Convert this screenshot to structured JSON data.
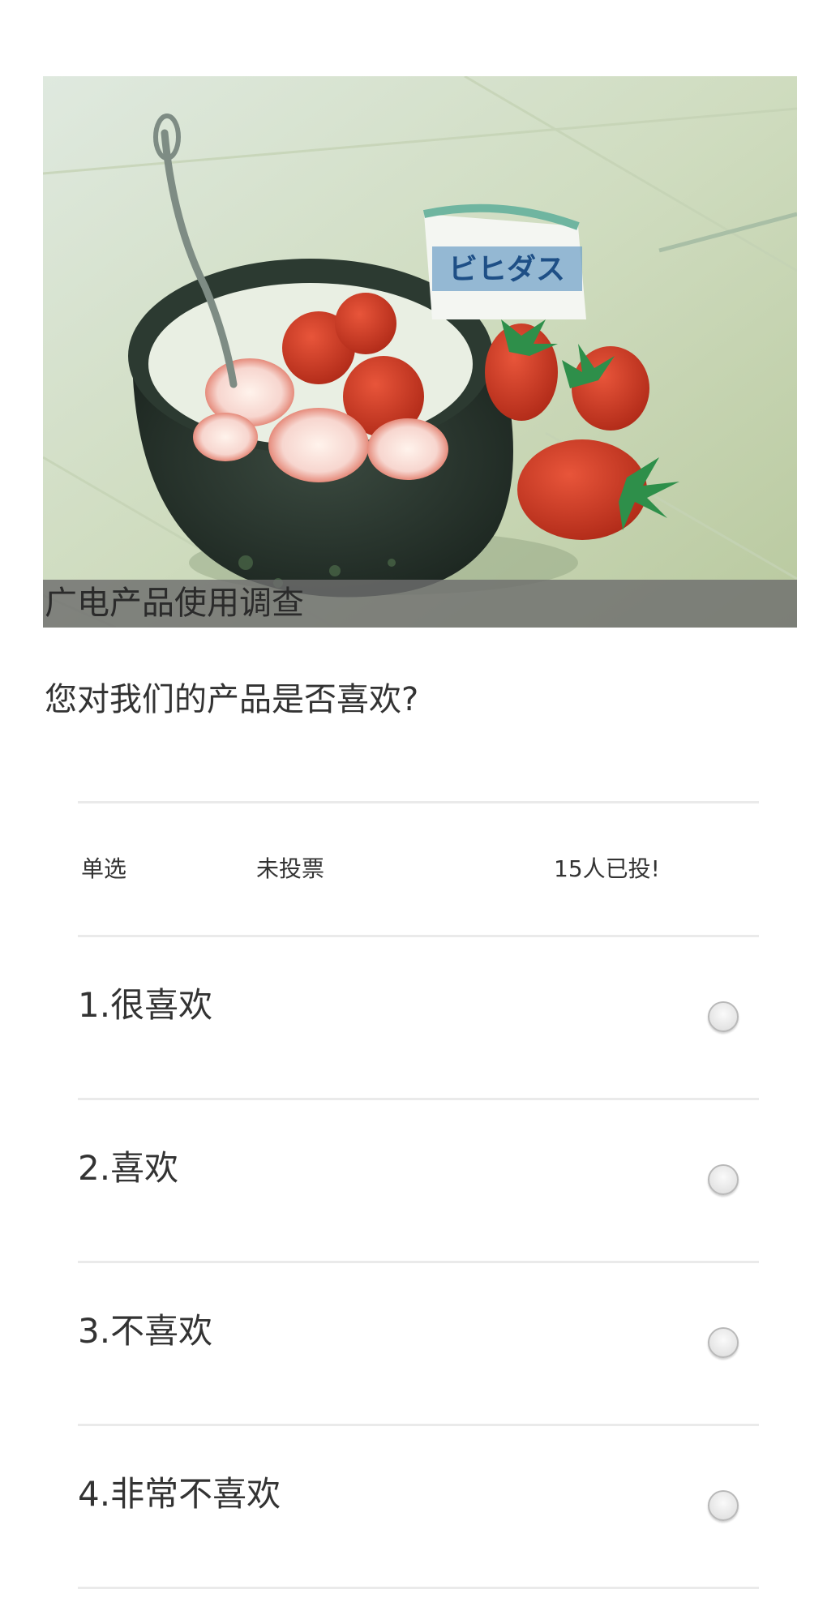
{
  "banner": {
    "image_alt": "bowl of strawberries with spoon and yogurt cup",
    "yogurt_brand": "ビヒダス"
  },
  "survey": {
    "title": "广电产品使用调查",
    "question": "您对我们的产品是否喜欢?",
    "type": "单选",
    "status": "未投票",
    "count": "15人已投!"
  },
  "options": [
    {
      "label": "1.很喜欢",
      "selected": false
    },
    {
      "label": "2.喜欢",
      "selected": false
    },
    {
      "label": "3.不喜欢",
      "selected": false
    },
    {
      "label": "4.非常不喜欢",
      "selected": false
    }
  ],
  "colors": {
    "caption_bg": "#6e6e6e",
    "divider": "#eaeaea",
    "text": "#333333"
  }
}
